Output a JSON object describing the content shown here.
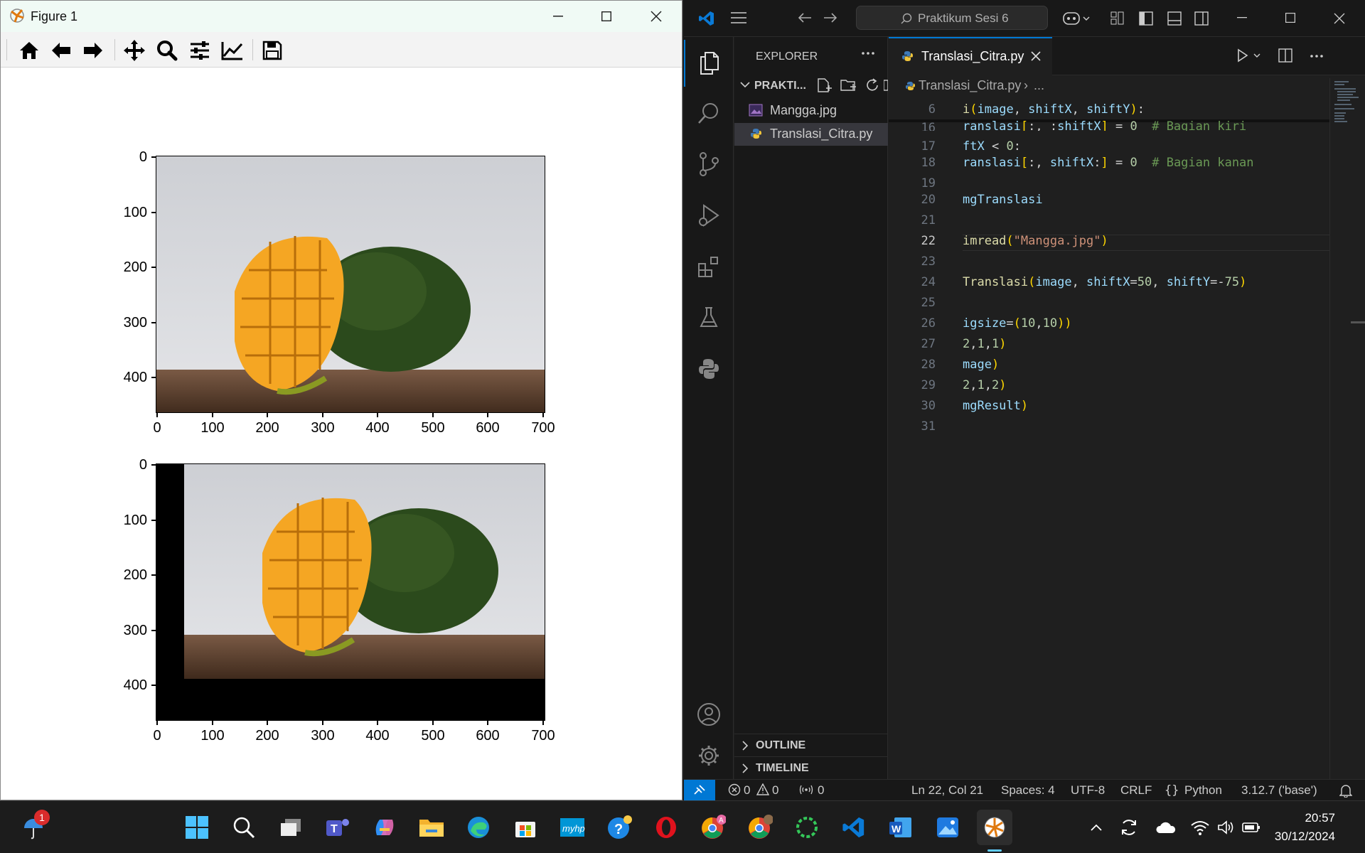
{
  "mpl": {
    "title": "Figure 1",
    "toolbar": [
      "home-icon",
      "back-icon",
      "forward-icon",
      "pan-icon",
      "zoom-icon",
      "configure-icon",
      "edit-curve-icon",
      "save-icon"
    ],
    "plot1_ticks_y": [
      "0",
      "100",
      "200",
      "300",
      "400"
    ],
    "plot1_ticks_x": [
      "0",
      "100",
      "200",
      "300",
      "400",
      "500",
      "600",
      "700"
    ],
    "plot2_ticks_y": [
      "0",
      "100",
      "200",
      "300",
      "400"
    ],
    "plot2_ticks_x": [
      "0",
      "100",
      "200",
      "300",
      "400",
      "500",
      "600",
      "700"
    ]
  },
  "vscode": {
    "search": "Praktikum Sesi 6",
    "explorer_title": "EXPLORER",
    "folder": "PRAKTI...",
    "files": [
      "Mangga.jpg",
      "Translasi_Citra.py"
    ],
    "outline": "OUTLINE",
    "timeline": "TIMELINE",
    "tab": "Translasi_Citra.py",
    "breadcrumb": "Translasi_Citra.py",
    "breadcrumb_more": "...",
    "line_numbers": [
      "6",
      "16",
      "17",
      "18",
      "19",
      "20",
      "21",
      "22",
      "23",
      "24",
      "25",
      "26",
      "27",
      "28",
      "29",
      "30",
      "31"
    ],
    "status": {
      "errors": "0",
      "warnings": "0",
      "ports": "0",
      "position": "Ln 22, Col 21",
      "spaces": "Spaces: 4",
      "encoding": "UTF-8",
      "eol": "CRLF",
      "lang": "Python",
      "interpreter": "3.12.7 ('base')"
    }
  },
  "taskbar": {
    "weather_badge": "1",
    "time": "20:57",
    "date": "30/12/2024"
  }
}
